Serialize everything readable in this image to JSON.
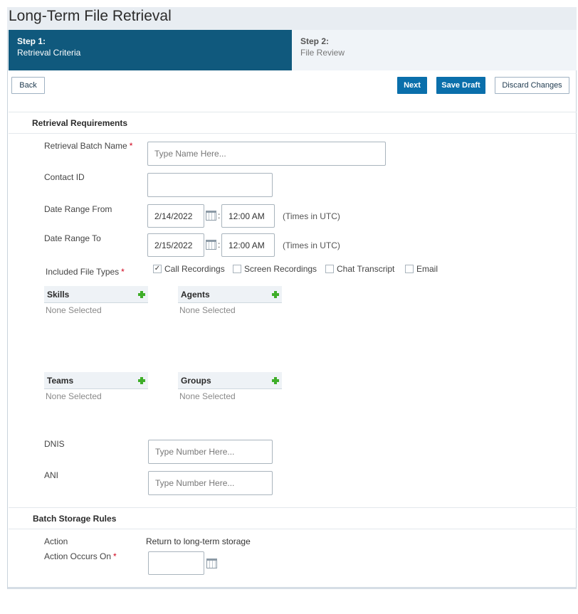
{
  "page": {
    "title": "Long-Term File Retrieval"
  },
  "steps": [
    {
      "num": "Step 1:",
      "label": "Retrieval Criteria",
      "active": true
    },
    {
      "num": "Step 2:",
      "label": "File Review",
      "active": false
    }
  ],
  "toolbar": {
    "back_label": "Back",
    "next_label": "Next",
    "save_draft_label": "Save Draft",
    "discard_label": "Discard Changes"
  },
  "retrieval": {
    "section_title": "Retrieval Requirements",
    "batch_name": {
      "label": "Retrieval Batch Name",
      "required": "*",
      "placeholder": "Type Name Here...",
      "value": ""
    },
    "contact_id": {
      "label": "Contact ID",
      "value": ""
    },
    "date_from": {
      "label": "Date Range From",
      "date": "2/14/2022",
      "time": "12:00 AM",
      "hint": "(Times in UTC)"
    },
    "date_to": {
      "label": "Date Range To",
      "date": "2/15/2022",
      "time": "12:00 AM",
      "hint": "(Times in UTC)"
    },
    "file_types": {
      "label": "Included File Types",
      "required": "*",
      "options": [
        {
          "label": "Call Recordings",
          "checked": true,
          "mark": "✓"
        },
        {
          "label": "Screen Recordings",
          "checked": false,
          "mark": ""
        },
        {
          "label": "Chat Transcript",
          "checked": false,
          "mark": ""
        },
        {
          "label": "Email",
          "checked": false,
          "mark": ""
        }
      ]
    },
    "pickers": {
      "skills": {
        "title": "Skills",
        "empty": "None Selected"
      },
      "agents": {
        "title": "Agents",
        "empty": "None Selected"
      },
      "teams": {
        "title": "Teams",
        "empty": "None Selected"
      },
      "groups": {
        "title": "Groups",
        "empty": "None Selected"
      }
    },
    "dnis": {
      "label": "DNIS",
      "placeholder": "Type Number Here..."
    },
    "ani": {
      "label": "ANI",
      "placeholder": "Type Number Here..."
    }
  },
  "storage": {
    "section_title": "Batch Storage Rules",
    "action_label": "Action",
    "action_value": "Return to long-term storage",
    "occurs_label": "Action Occurs On",
    "required": "*",
    "occurs_value": ""
  },
  "icons": {
    "calendar": "calendar-icon",
    "add": "plus-icon",
    "check": "check-icon"
  },
  "colors": {
    "step_active_bg": "#10597d",
    "primary_button": "#0a6fab",
    "required_star": "#d0021b",
    "add_icon": "#3fae29"
  }
}
